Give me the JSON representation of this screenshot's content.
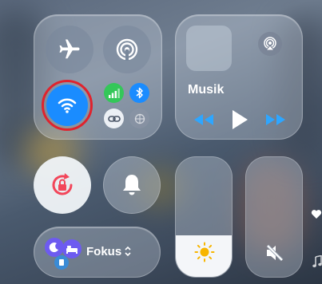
{
  "connectivity": {
    "airplane_icon": "airplane-icon",
    "airdrop_icon": "airdrop-icon",
    "wifi_icon": "wifi-icon",
    "cellular_icon": "cellular-icon",
    "bluetooth_icon": "bluetooth-icon",
    "hotspot_icon": "personal-hotspot-icon",
    "vpn_icon": "vpn-icon",
    "wifi_highlight_color": "#e0232d",
    "wifi_color": "#1a8cff",
    "cellular_color": "#34c759",
    "bluetooth_color": "#1a8cff"
  },
  "music": {
    "label": "Musik",
    "airplay_icon": "airplay-icon",
    "rewind_icon": "rewind-icon",
    "play_icon": "play-icon",
    "forward_icon": "fast-forward-icon"
  },
  "controls": {
    "rotation_lock_icon": "rotation-lock-icon",
    "bell_icon": "bell-icon",
    "focus_label": "Fokus",
    "focus_chevron": "⌃⌄",
    "brightness_icon": "sun-icon",
    "volume_icon": "speaker-muted-icon",
    "brightness_level": 0.35,
    "volume_level": 0.0
  },
  "edge": {
    "heart_icon": "heart-icon",
    "music_note_icon": "music-note-icon"
  }
}
